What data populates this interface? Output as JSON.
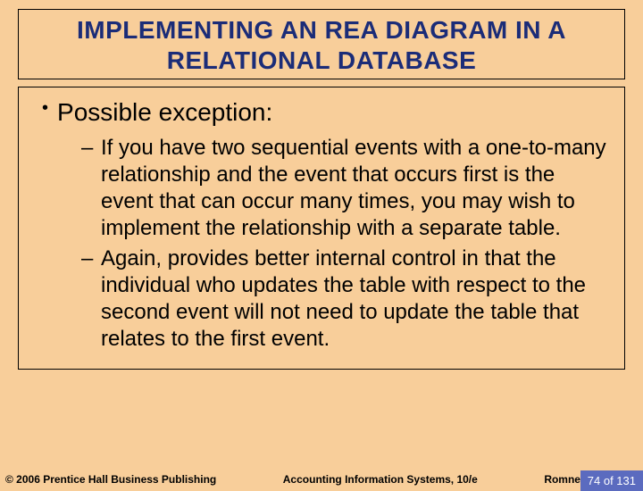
{
  "title": "IMPLEMENTING AN REA DIAGRAM IN A RELATIONAL DATABASE",
  "bullet": {
    "label": "Possible exception:",
    "subs": [
      "If you have two sequential events with a one-to-many relationship and the event that occurs first is the event that can occur many times, you may wish to implement the relationship with a separate table.",
      "Again, provides better internal control in that the individual who updates the table with respect to the second event will not need to update the table that relates to the first event."
    ]
  },
  "footer": {
    "copyright": "© 2006 Prentice Hall Business Publishing",
    "center": "Accounting Information Systems, 10/e",
    "authors": "Romney/Steinbart",
    "page": "74 of 131"
  }
}
